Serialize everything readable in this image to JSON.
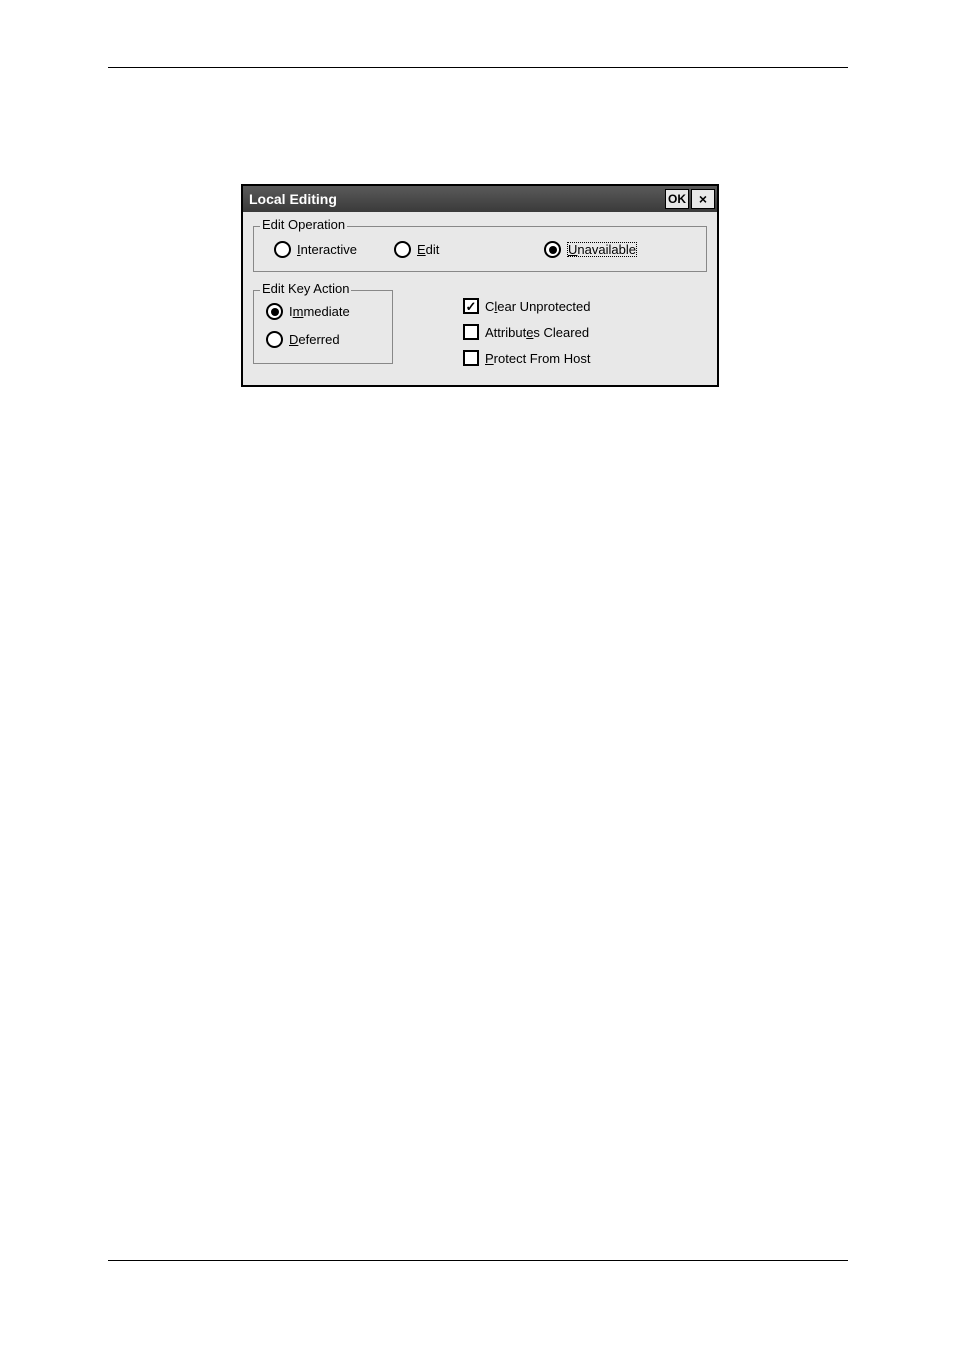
{
  "dialog": {
    "title": "Local Editing",
    "ok_label": "OK",
    "close_label": "×"
  },
  "edit_operation": {
    "legend": "Edit Operation",
    "interactive": {
      "prefix": "I",
      "rest": "nteractive",
      "selected": false
    },
    "edit": {
      "prefix": "E",
      "rest": "dit",
      "selected": false
    },
    "unavailable": {
      "prefix": "U",
      "rest": "navailable",
      "selected": true
    }
  },
  "edit_key_action": {
    "legend": "Edit Key Action",
    "immediate": {
      "pre": "I",
      "mid": "m",
      "rest": "mediate",
      "selected": true
    },
    "deferred": {
      "prefix": "D",
      "rest": "eferred",
      "selected": false
    }
  },
  "checkboxes": {
    "clear_unprotected": {
      "pre": "C",
      "mid": "l",
      "rest": "ear Unprotected",
      "checked": true
    },
    "attributes_cleared": {
      "pre": "Attribut",
      "mid": "e",
      "rest": "s Cleared",
      "checked": false
    },
    "protect_from_host": {
      "prefix": "P",
      "rest": "rotect From Host",
      "checked": false
    }
  }
}
